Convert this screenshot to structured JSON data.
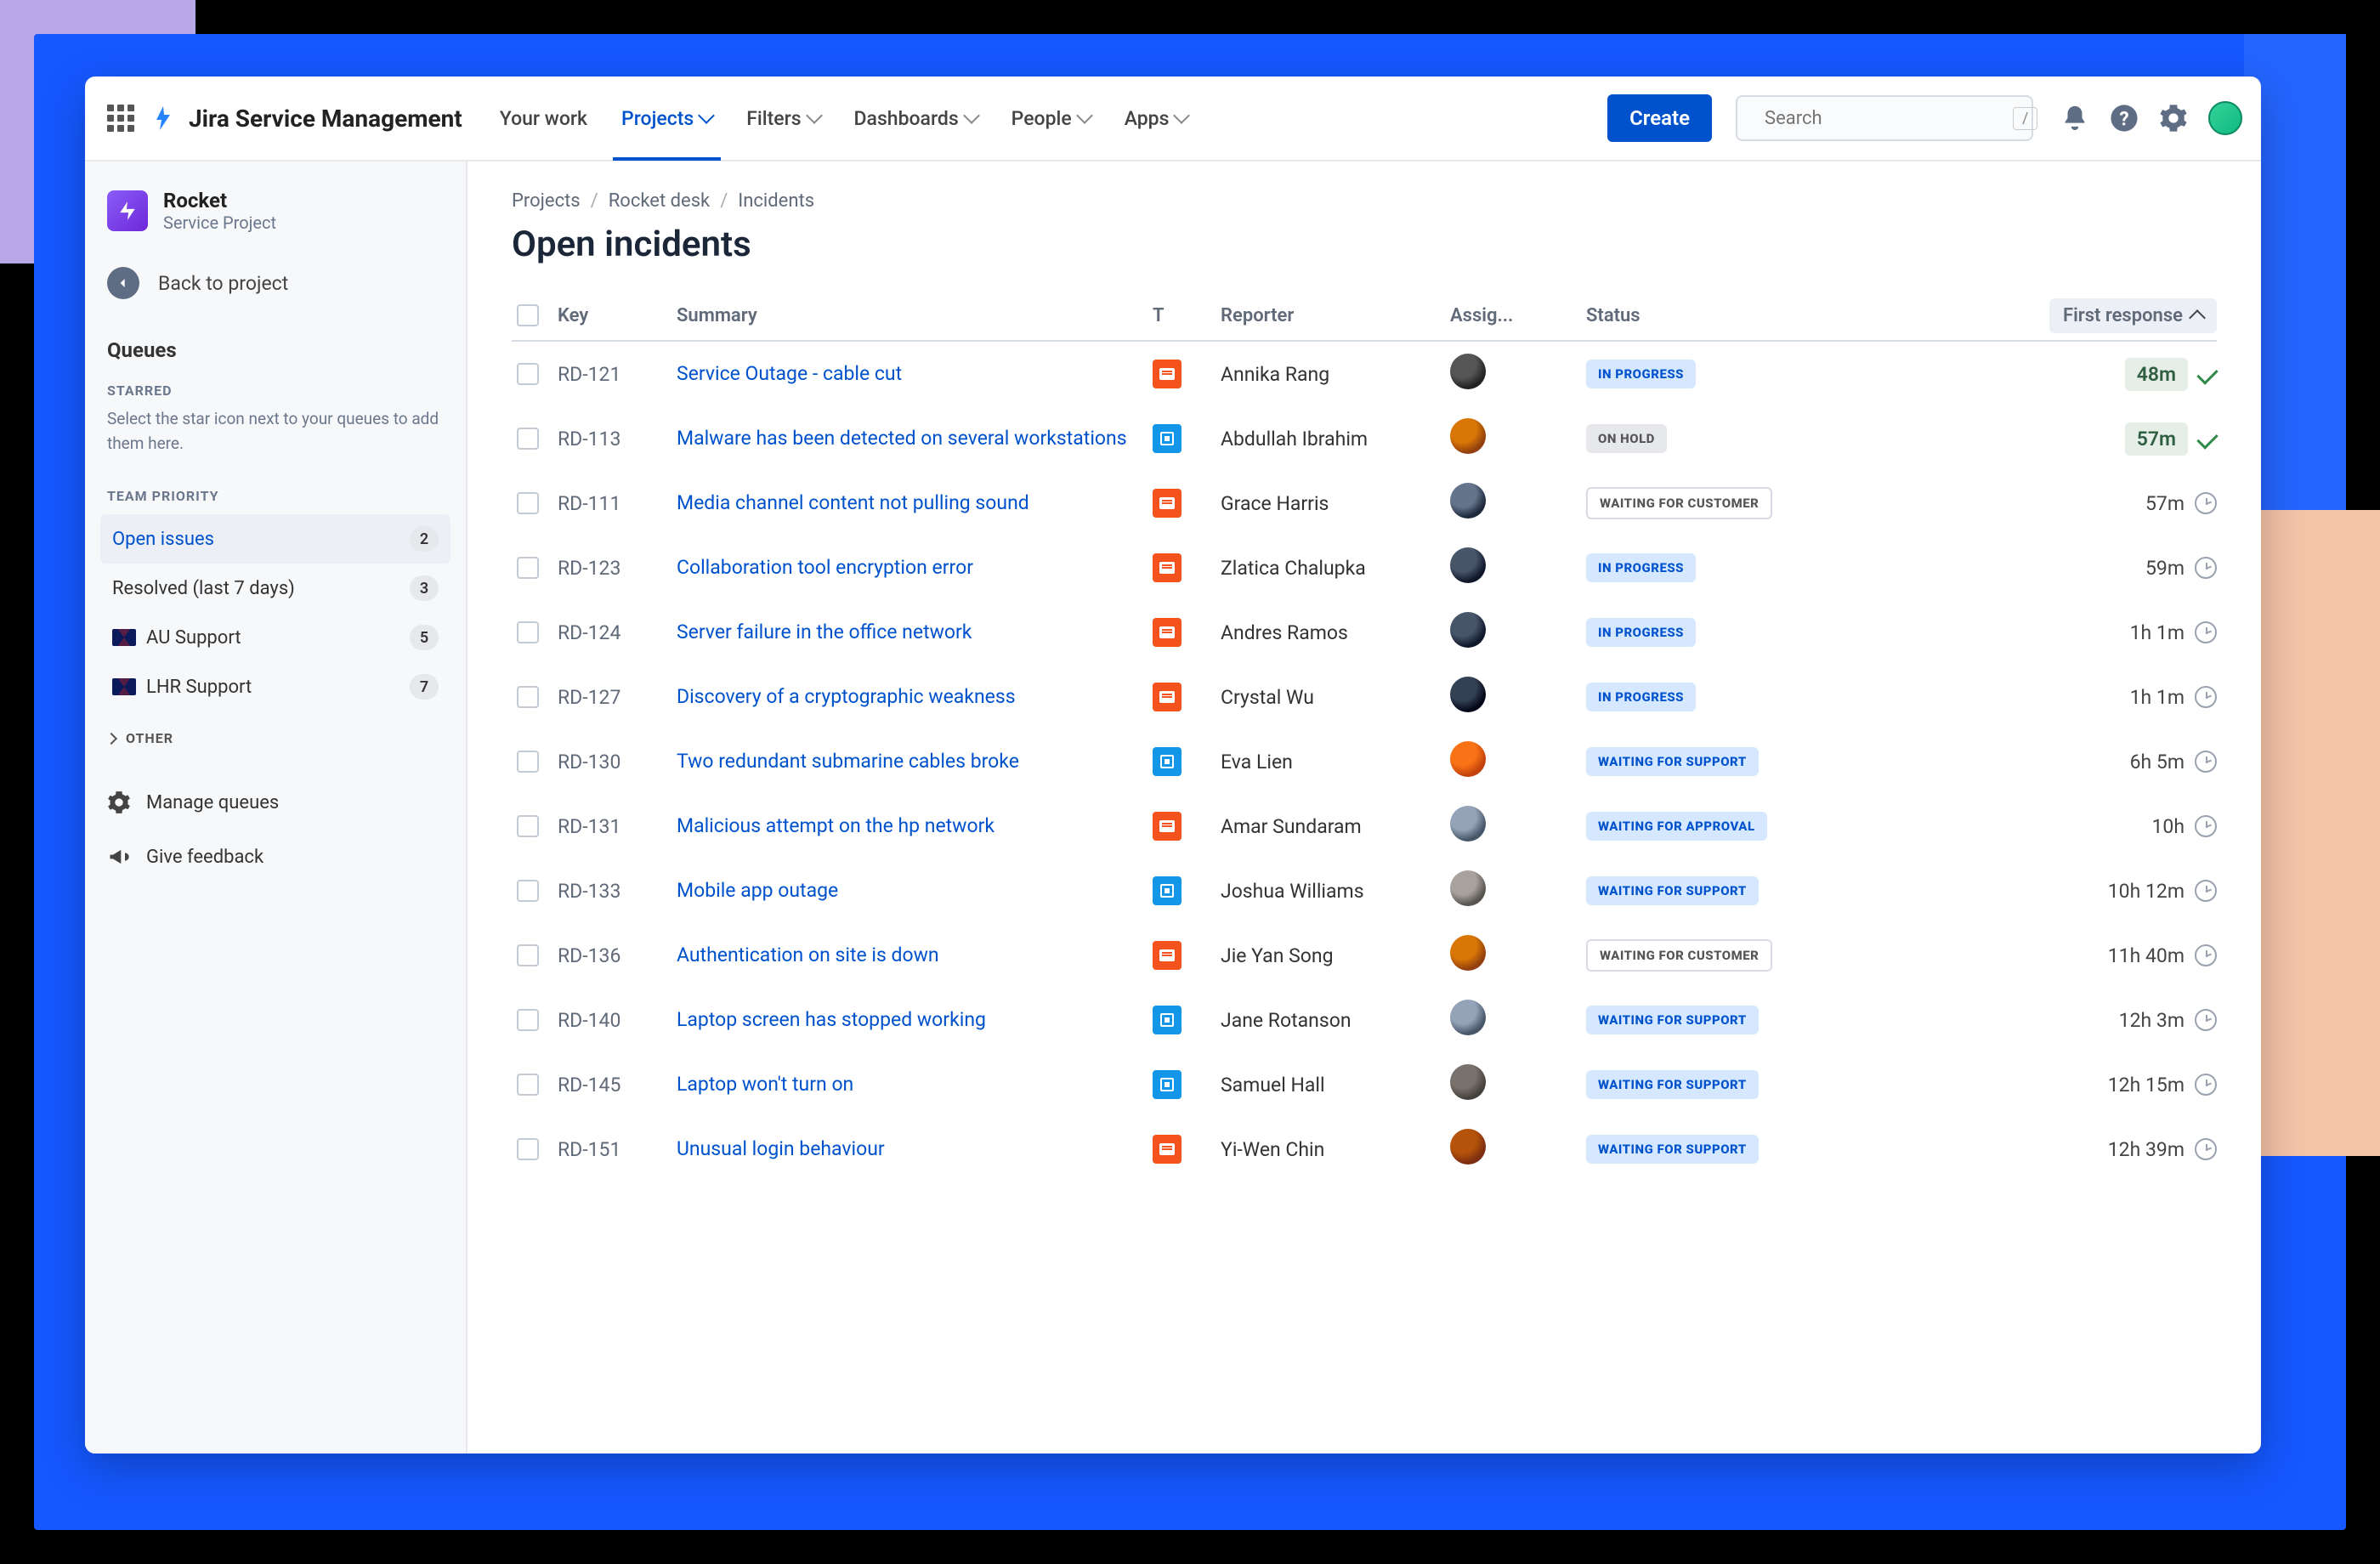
{
  "product_name": "Jira Service Management",
  "nav": {
    "your_work": "Your work",
    "projects": "Projects",
    "filters": "Filters",
    "dashboards": "Dashboards",
    "people": "People",
    "apps": "Apps"
  },
  "create_label": "Create",
  "search_placeholder": "Search",
  "search_shortcut": "/",
  "sidebar": {
    "project_name": "Rocket",
    "project_type": "Service Project",
    "back_label": "Back to project",
    "queues_title": "Queues",
    "starred_header": "STARRED",
    "starred_help": "Select the star icon next to your queues to add them here.",
    "team_header": "TEAM PRIORITY",
    "items": [
      {
        "label": "Open issues",
        "count": "2",
        "active": true
      },
      {
        "label": "Resolved (last 7 days)",
        "count": "3"
      },
      {
        "label": "AU Support",
        "count": "5",
        "flag": "au"
      },
      {
        "label": "LHR Support",
        "count": "7",
        "flag": "uk"
      }
    ],
    "other_label": "OTHER",
    "manage_label": "Manage queues",
    "feedback_label": "Give feedback"
  },
  "breadcrumbs": {
    "a": "Projects",
    "b": "Rocket desk",
    "c": "Incidents"
  },
  "page_title": "Open incidents",
  "columns": {
    "key": "Key",
    "summary": "Summary",
    "t": "T",
    "reporter": "Reporter",
    "assignee": "Assig...",
    "status": "Status",
    "first": "First response"
  },
  "rows": [
    {
      "key": "RD-121",
      "summary": "Service Outage - cable cut",
      "type": "orange",
      "reporter": "Annika Rang",
      "status": "IN PROGRESS",
      "st": "progress",
      "first": "48m",
      "mark": "check"
    },
    {
      "key": "RD-113",
      "summary": "Malware has been detected on several workstations",
      "type": "blue",
      "reporter": "Abdullah Ibrahim",
      "status": "ON HOLD",
      "st": "hold",
      "first": "57m",
      "mark": "check"
    },
    {
      "key": "RD-111",
      "summary": "Media channel content not pulling sound",
      "type": "orange",
      "reporter": "Grace Harris",
      "status": "WAITING FOR CUSTOMER",
      "st": "wc",
      "first": "57m",
      "mark": "clock"
    },
    {
      "key": "RD-123",
      "summary": "Collaboration tool encryption error",
      "type": "orange",
      "reporter": "Zlatica Chalupka",
      "status": "IN PROGRESS",
      "st": "progress",
      "first": "59m",
      "mark": "clock"
    },
    {
      "key": "RD-124",
      "summary": "Server failure in the office network",
      "type": "orange",
      "reporter": "Andres Ramos",
      "status": "IN PROGRESS",
      "st": "progress",
      "first": "1h 1m",
      "mark": "clock"
    },
    {
      "key": "RD-127",
      "summary": "Discovery of a cryptographic weakness",
      "type": "orange",
      "reporter": "Crystal Wu",
      "status": "IN PROGRESS",
      "st": "progress",
      "first": "1h 1m",
      "mark": "clock"
    },
    {
      "key": "RD-130",
      "summary": "Two redundant submarine cables broke",
      "type": "blue",
      "reporter": "Eva Lien",
      "status": "WAITING FOR SUPPORT",
      "st": "ws",
      "first": "6h 5m",
      "mark": "clock"
    },
    {
      "key": "RD-131",
      "summary": "Malicious attempt on the hp network",
      "type": "orange",
      "reporter": "Amar Sundaram",
      "status": "WAITING FOR APPROVAL",
      "st": "wa",
      "first": "10h",
      "mark": "clock"
    },
    {
      "key": "RD-133",
      "summary": "Mobile app outage",
      "type": "blue",
      "reporter": "Joshua Williams",
      "status": "WAITING FOR SUPPORT",
      "st": "ws",
      "first": "10h 12m",
      "mark": "clock"
    },
    {
      "key": "RD-136",
      "summary": "Authentication on site is down",
      "type": "orange",
      "reporter": "Jie Yan Song",
      "status": "WAITING FOR CUSTOMER",
      "st": "wc",
      "first": "11h 40m",
      "mark": "clock"
    },
    {
      "key": "RD-140",
      "summary": "Laptop screen has stopped working",
      "type": "blue",
      "reporter": "Jane Rotanson",
      "status": "WAITING FOR SUPPORT",
      "st": "ws",
      "first": "12h 3m",
      "mark": "clock"
    },
    {
      "key": "RD-145",
      "summary": "Laptop won't turn on",
      "type": "blue",
      "reporter": "Samuel Hall",
      "status": "WAITING FOR SUPPORT",
      "st": "ws",
      "first": "12h 15m",
      "mark": "clock"
    },
    {
      "key": "RD-151",
      "summary": "Unusual login behaviour",
      "type": "orange",
      "reporter": "Yi-Wen Chin",
      "status": "WAITING FOR SUPPORT",
      "st": "ws",
      "first": "12h 39m",
      "mark": "clock"
    }
  ],
  "avatar_colors": [
    "#555 #222",
    "#d97706 #92400e",
    "#64748b #1e293b",
    "#475569 #0f172a",
    "#475569 #0f172a",
    "#334155 #020617",
    "#f97316 #c2410c",
    "#94a3b8 #475569",
    "#a8a29e #57534e",
    "#d97706 #92400e",
    "#94a3b8 #475569",
    "#78716c #44403c",
    "#b45309 #7c2d12"
  ]
}
